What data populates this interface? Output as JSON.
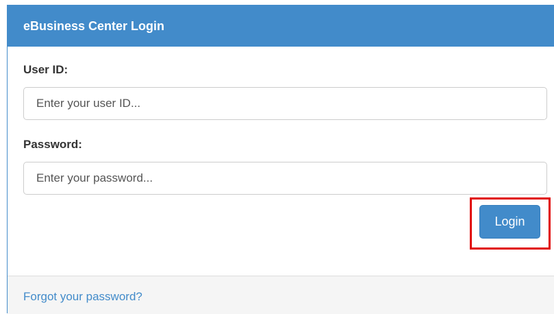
{
  "header": {
    "title": "eBusiness Center Login"
  },
  "form": {
    "user_id_label": "User ID:",
    "user_id_placeholder": "Enter your user ID...",
    "user_id_value": "",
    "password_label": "Password:",
    "password_placeholder": "Enter your password...",
    "password_value": "",
    "login_label": "Login"
  },
  "footer": {
    "forgot_link": "Forgot your password?"
  },
  "colors": {
    "primary": "#428bca",
    "highlight": "#e00000"
  }
}
